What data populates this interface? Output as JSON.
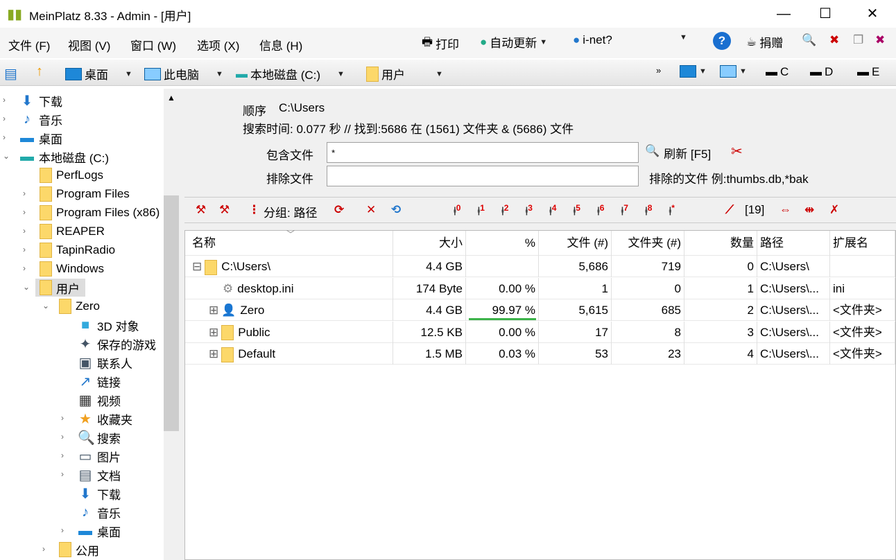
{
  "window": {
    "title": "MeinPlatz 8.33 - Admin - [用户]"
  },
  "menu": [
    "文件 (F)",
    "视图 (V)",
    "窗口 (W)",
    "选项 (X)",
    "信息 (H)"
  ],
  "toolbar": {
    "print": "打印",
    "auto_update": "自动更新",
    "inet": "i-net?",
    "donate": "捐赠"
  },
  "nav": {
    "crumbs": [
      "桌面",
      "此电脑",
      "本地磁盘 (C:)",
      "用户"
    ],
    "drives": [
      "C",
      "D",
      "E"
    ]
  },
  "tree": [
    {
      "label": "下载",
      "level": 0,
      "icon": "download-icon"
    },
    {
      "label": "音乐",
      "level": 0,
      "icon": "music-icon"
    },
    {
      "label": "桌面",
      "level": 0,
      "icon": "desktop-icon"
    },
    {
      "label": "本地磁盘 (C:)",
      "level": 0,
      "icon": "drive-icon",
      "expanded": true
    },
    {
      "label": "PerfLogs",
      "level": 1,
      "icon": "folder-icon"
    },
    {
      "label": "Program Files",
      "level": 1,
      "icon": "folder-icon",
      "exp": true
    },
    {
      "label": "Program Files (x86)",
      "level": 1,
      "icon": "folder-icon",
      "exp": true
    },
    {
      "label": "REAPER",
      "level": 1,
      "icon": "folder-icon",
      "exp": true
    },
    {
      "label": "TapinRadio",
      "level": 1,
      "icon": "folder-icon",
      "exp": true
    },
    {
      "label": "Windows",
      "level": 1,
      "icon": "folder-icon",
      "exp": true
    },
    {
      "label": "用户",
      "level": 1,
      "icon": "folder-icon",
      "expanded": true,
      "selected": true
    },
    {
      "label": "Zero",
      "level": 2,
      "icon": "folder-icon",
      "expanded": true
    },
    {
      "label": "3D 对象",
      "level": 3,
      "icon": "cube-icon"
    },
    {
      "label": "保存的游戏",
      "level": 3,
      "icon": "game-icon"
    },
    {
      "label": "联系人",
      "level": 3,
      "icon": "contacts-icon"
    },
    {
      "label": "链接",
      "level": 3,
      "icon": "link-icon"
    },
    {
      "label": "视频",
      "level": 3,
      "icon": "video-icon"
    },
    {
      "label": "收藏夹",
      "level": 3,
      "icon": "star-icon",
      "exp": true
    },
    {
      "label": "搜索",
      "level": 3,
      "icon": "search-icon",
      "exp": true
    },
    {
      "label": "图片",
      "level": 3,
      "icon": "picture-icon",
      "exp": true
    },
    {
      "label": "文档",
      "level": 3,
      "icon": "document-icon",
      "exp": true
    },
    {
      "label": "下载",
      "level": 3,
      "icon": "download-icon"
    },
    {
      "label": "音乐",
      "level": 3,
      "icon": "music-icon"
    },
    {
      "label": "桌面",
      "level": 3,
      "icon": "desktop-icon",
      "exp": true
    },
    {
      "label": "公用",
      "level": 2,
      "icon": "folder-icon",
      "exp": true
    }
  ],
  "info": {
    "order_label": "顺序",
    "order_path": "C:\\Users",
    "search_line": "搜索时间: 0.077 秒 //  找到:5686 在 (1561) 文件夹 & (5686) 文件"
  },
  "filter": {
    "include_label": "包含文件",
    "include_value": "*",
    "refresh": "刷新 [F5]",
    "exclude_label": "排除文件",
    "exclude_value": "",
    "exclude_hint": "排除的文件 例:thumbs.db,*bak"
  },
  "toolbar2": {
    "group": "分组: 路径",
    "levels": [
      "0",
      "1",
      "2",
      "3",
      "4",
      "5",
      "6",
      "7",
      "8",
      "*"
    ],
    "count": "[19]"
  },
  "table": {
    "columns": [
      "名称",
      "大小",
      "%",
      "文件 (#)",
      "文件夹 (#)",
      "数量",
      "路径",
      "扩展名"
    ],
    "rows": [
      {
        "name": "C:\\Users\\",
        "size": "4.4 GB",
        "pct": "",
        "files": "5,686",
        "folders": "719",
        "num": "0",
        "path": "C:\\Users\\",
        "ext": "",
        "indent": 0,
        "exp": "⊟",
        "icon": "folder"
      },
      {
        "name": "desktop.ini",
        "size": "174 Byte",
        "pct": "0.00 %",
        "files": "1",
        "folders": "0",
        "num": "1",
        "path": "C:\\Users\\...",
        "ext": "ini",
        "indent": 1,
        "exp": "",
        "icon": "file",
        "fill": 0
      },
      {
        "name": "Zero",
        "size": "4.4 GB",
        "pct": "99.97 %",
        "files": "5,615",
        "folders": "685",
        "num": "2",
        "path": "C:\\Users\\...",
        "ext": "<文件夹>",
        "indent": 1,
        "exp": "⊞",
        "icon": "user",
        "fill": 99.97
      },
      {
        "name": "Public",
        "size": "12.5 KB",
        "pct": "0.00 %",
        "files": "17",
        "folders": "8",
        "num": "3",
        "path": "C:\\Users\\...",
        "ext": "<文件夹>",
        "indent": 1,
        "exp": "⊞",
        "icon": "folder",
        "fill": 0
      },
      {
        "name": "Default",
        "size": "1.5 MB",
        "pct": "0.03 %",
        "files": "53",
        "folders": "23",
        "num": "4",
        "path": "C:\\Users\\...",
        "ext": "<文件夹>",
        "indent": 1,
        "exp": "⊞",
        "icon": "folder",
        "fill": 0.03
      }
    ]
  }
}
